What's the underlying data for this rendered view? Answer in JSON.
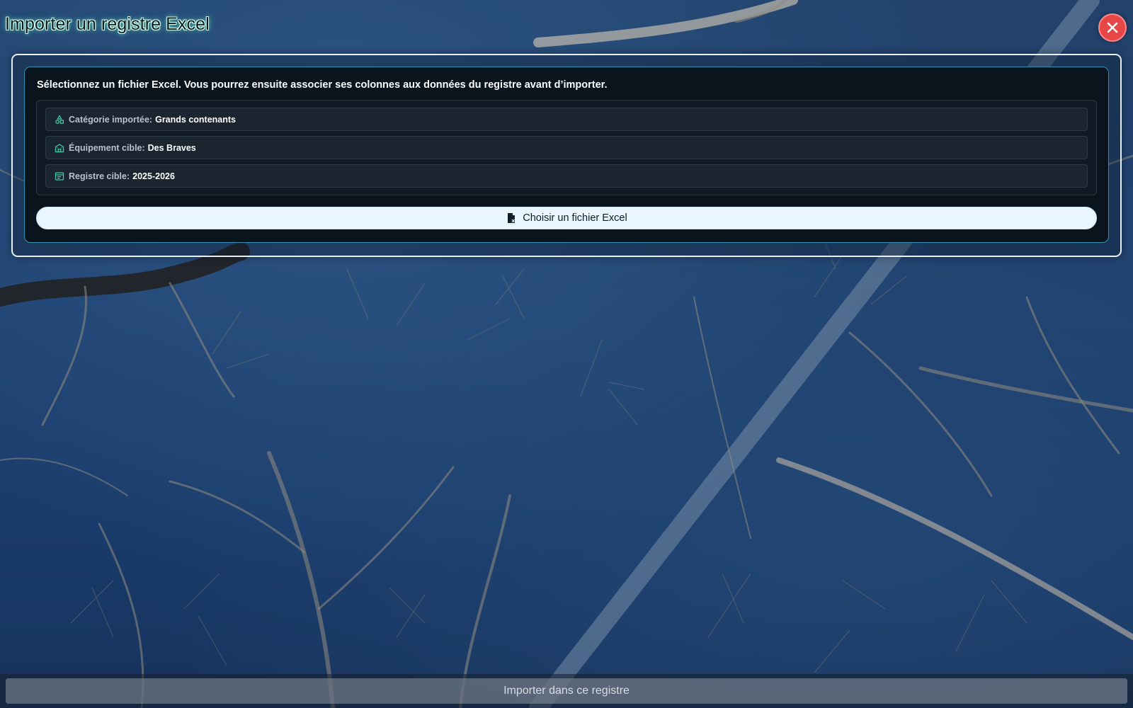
{
  "modal": {
    "title": "Importer un registre Excel",
    "intro": "Sélectionnez un fichier Excel. Vous pourrez ensuite associer ses colonnes aux données du registre avant d’importer.",
    "info": [
      {
        "icon": "shapes-icon",
        "label": "Catégorie importée:",
        "value": "Grands contenants"
      },
      {
        "icon": "building-icon",
        "label": "Équipement cible:",
        "value": "Des Braves"
      },
      {
        "icon": "register-icon",
        "label": "Registre cible:",
        "value": "2025-2026"
      }
    ],
    "choose_file_label": "Choisir un fichier Excel",
    "choose_file_icon": "excel-file-icon",
    "close_icon": "close-icon",
    "import_label": "Importer dans ce registre"
  },
  "colors": {
    "accent": "#2f8fb3",
    "close_button": "#e74646",
    "info_icon": "#3fc7a6"
  }
}
